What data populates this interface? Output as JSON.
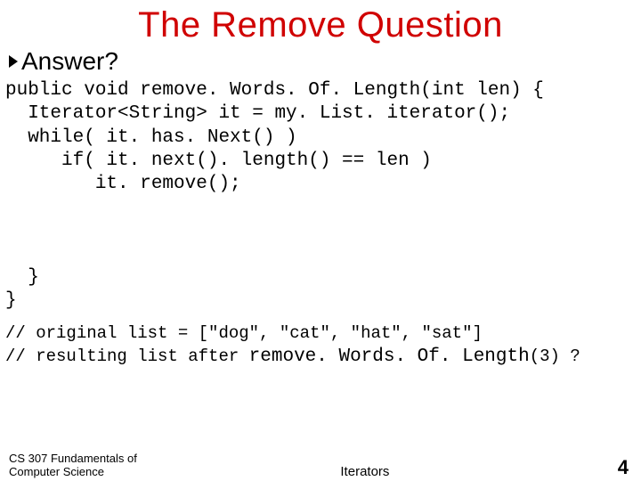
{
  "title": "The Remove Question",
  "bullet": "Answer?",
  "code_lines": [
    "public void remove. Words. Of. Length(int len) {",
    "  Iterator<String> it = my. List. iterator();",
    "  while( it. has. Next() )",
    "     if( it. next(). length() == len )",
    "        it. remove();",
    "",
    "",
    "",
    "  }",
    "}"
  ],
  "comment_lines": [
    "// original list = [\"dog\", \"cat\", \"hat\", \"sat\"]"
  ],
  "last_line_prefix": "// resulting list after ",
  "last_line_call": "remove. Words. Of. Length",
  "last_line_suffix": "(3) ?",
  "footer": {
    "left": "CS 307 Fundamentals of\nComputer Science",
    "center": "Iterators",
    "page": "4"
  }
}
